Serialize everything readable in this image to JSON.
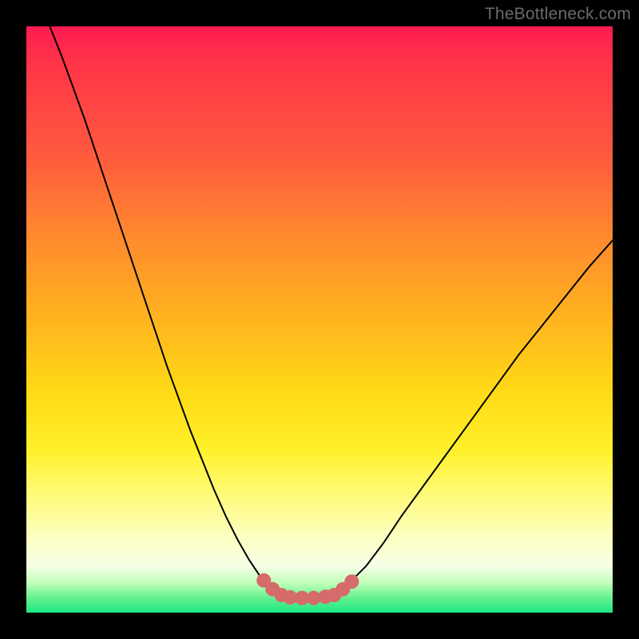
{
  "watermark": "TheBottleneck.com",
  "chart_data": {
    "type": "line",
    "title": "",
    "xlabel": "",
    "ylabel": "",
    "xlim": [
      0,
      100
    ],
    "ylim": [
      0,
      100
    ],
    "series": [
      {
        "name": "bottleneck-curve-left",
        "x": [
          4,
          6,
          8,
          10,
          12,
          14,
          16,
          18,
          20,
          22,
          24,
          26,
          28,
          30,
          32,
          34,
          36,
          38,
          40,
          41.5,
          43
        ],
        "y": [
          100,
          95,
          89.5,
          84,
          78,
          72,
          66,
          60,
          54,
          48,
          42,
          36.5,
          31,
          26,
          21,
          16.5,
          12.5,
          9,
          6,
          4,
          3
        ],
        "stroke": "#000000",
        "stroke_width": 2
      },
      {
        "name": "bottleneck-curve-bottom",
        "x": [
          43,
          45,
          47,
          49,
          51,
          52.5
        ],
        "y": [
          3,
          2.6,
          2.5,
          2.5,
          2.7,
          3
        ],
        "stroke": "#000000",
        "stroke_width": 2
      },
      {
        "name": "bottleneck-curve-right",
        "x": [
          52.5,
          55,
          58,
          61,
          64,
          68,
          72,
          76,
          80,
          84,
          88,
          92,
          96,
          100
        ],
        "y": [
          3,
          5,
          8,
          12,
          16.5,
          22,
          27.5,
          33,
          38.5,
          44,
          49,
          54,
          59,
          63.5
        ],
        "stroke": "#000000",
        "stroke_width": 2
      },
      {
        "name": "highlight-dots",
        "type": "scatter",
        "x": [
          40.5,
          42,
          43.5,
          45,
          47,
          49,
          51,
          52.5,
          54,
          55.5
        ],
        "y": [
          5.5,
          4,
          3,
          2.6,
          2.5,
          2.5,
          2.7,
          3,
          4,
          5.3
        ],
        "marker_color": "#d66b6b",
        "marker_radius": 9
      }
    ],
    "background_gradient": {
      "direction": "top-to-bottom",
      "stops": [
        {
          "pos": 0.0,
          "color": "#ff1a52"
        },
        {
          "pos": 0.22,
          "color": "#ff5a3e"
        },
        {
          "pos": 0.5,
          "color": "#ffb41f"
        },
        {
          "pos": 0.72,
          "color": "#fff029"
        },
        {
          "pos": 0.87,
          "color": "#fdffc0"
        },
        {
          "pos": 0.95,
          "color": "#bfffb8"
        },
        {
          "pos": 1.0,
          "color": "#1de885"
        }
      ]
    }
  }
}
